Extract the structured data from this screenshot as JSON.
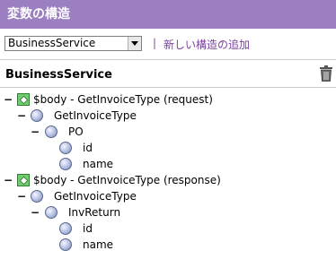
{
  "panel": {
    "title": "変数の構造"
  },
  "controls": {
    "select_value": "BusinessService",
    "separator": "|",
    "add_link": "新しい構造の追加"
  },
  "section": {
    "title": "BusinessService"
  },
  "tree": [
    {
      "label": "$body - GetInvoiceType (request)",
      "icon": "green-diamond-icon",
      "expander": "−"
    },
    {
      "label": "GetInvoiceType",
      "icon": "circle-icon",
      "expander": "−"
    },
    {
      "label": "PO",
      "icon": "circle-icon",
      "expander": "−"
    },
    {
      "label": "id",
      "icon": "circle-icon",
      "expander": ""
    },
    {
      "label": "name",
      "icon": "circle-icon",
      "expander": ""
    },
    {
      "label": "$body - GetInvoiceType (response)",
      "icon": "green-diamond-icon",
      "expander": "−"
    },
    {
      "label": "GetInvoiceType",
      "icon": "circle-icon",
      "expander": "−"
    },
    {
      "label": "InvReturn",
      "icon": "circle-icon",
      "expander": "−"
    },
    {
      "label": "id",
      "icon": "circle-icon",
      "expander": ""
    },
    {
      "label": "name",
      "icon": "circle-icon",
      "expander": ""
    }
  ],
  "colors": {
    "header": "#9b7fc0",
    "link": "#7a3fa0"
  }
}
